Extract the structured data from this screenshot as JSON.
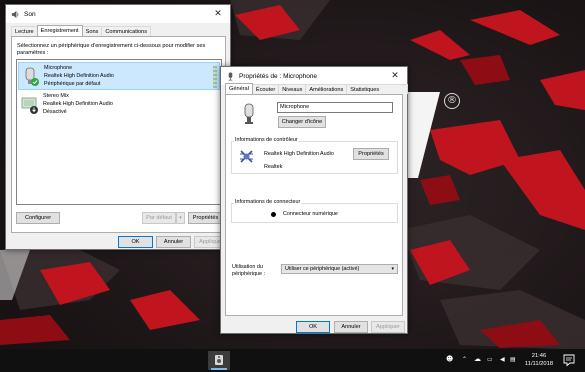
{
  "desktop": {
    "registered_mark": "®"
  },
  "son_window": {
    "title": "Son",
    "tabs": [
      "Lecture",
      "Enregistrement",
      "Sons",
      "Communications"
    ],
    "active_tab": "Enregistrement",
    "instruction": "Sélectionnez un périphérique d'enregistrement ci-dessous pour modifier ses paramètres :",
    "devices": [
      {
        "name": "Microphone",
        "driver": "Realtek High Definition Audio",
        "status": "Périphérique par défaut",
        "selected": true
      },
      {
        "name": "Stereo Mix",
        "driver": "Realtek High Definition Audio",
        "status": "Désactivé",
        "selected": false
      }
    ],
    "buttons": {
      "configure": "Configurer",
      "set_default": "Par défaut",
      "properties": "Propriétés",
      "ok": "OK",
      "cancel": "Annuler",
      "apply": "Appliquer"
    }
  },
  "props_window": {
    "title": "Propriétés de : Microphone",
    "tabs": [
      "Général",
      "Écouter",
      "Niveaux",
      "Améliorations",
      "Statistiques avancées"
    ],
    "active_tab": "Général",
    "device_name_value": "Microphone",
    "change_icon_button": "Changer d'icône",
    "controller_group": {
      "title": "Informations de contrôleur",
      "name": "Realtek High Definition Audio",
      "vendor": "Realtek",
      "properties_button": "Propriétés"
    },
    "connector_group": {
      "title": "Informations de connecteur",
      "connector": "Connecteur numérique"
    },
    "usage_label": "Utilisation du périphérique :",
    "usage_value": "Utiliser ce périphérique (activé)",
    "buttons": {
      "ok": "OK",
      "cancel": "Annuler",
      "apply": "Appliquer"
    }
  },
  "taskbar": {
    "time": "21:46",
    "date": "11/11/2018"
  },
  "colors": {
    "selection": "#cce8ff",
    "accent": "#0078d7",
    "status_ok": "#27a844",
    "taskbar": "#101010"
  }
}
